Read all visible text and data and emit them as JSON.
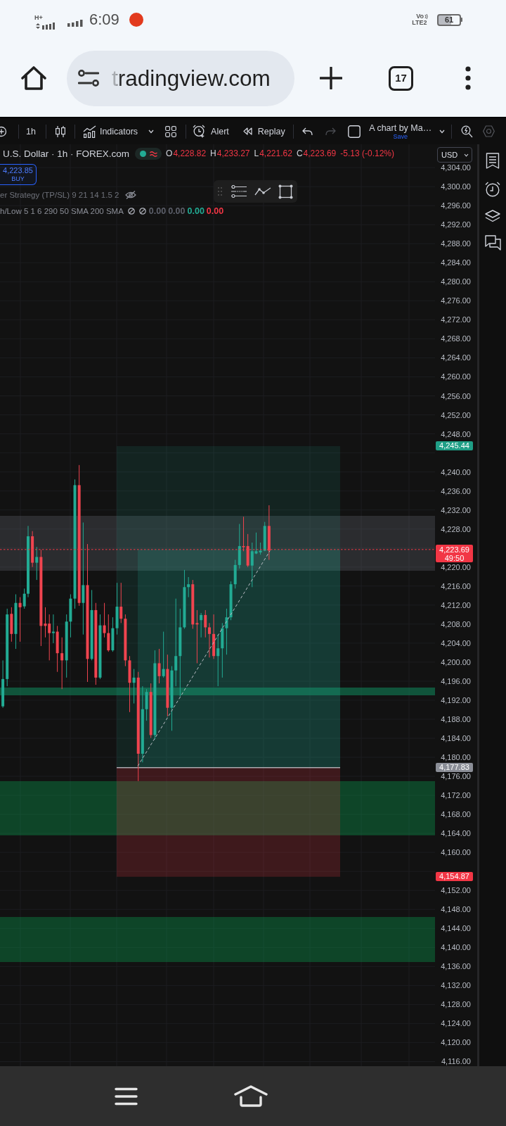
{
  "status_bar": {
    "network_type": "H+",
    "time": "6:09",
    "volte": "Vo",
    "lte": "LTE2",
    "battery": "61"
  },
  "browser": {
    "url": "tradingview.com",
    "tab_count": "17"
  },
  "toolbar": {
    "interval": "1h",
    "indicators": "Indicators",
    "alert": "Alert",
    "replay": "Replay",
    "layout_name": "A chart by Ma…",
    "save": "Save"
  },
  "legend": {
    "symbol": "U.S. Dollar · 1h · FOREX.com",
    "falling": true,
    "ohlc": [
      {
        "label": "O",
        "value": "4,228.82"
      },
      {
        "label": "H",
        "value": "4,233.27"
      },
      {
        "label": "L",
        "value": "4,221.62"
      },
      {
        "label": "C",
        "value": "4,223.69"
      }
    ],
    "change": "-5.13 (-0.12%)",
    "order_button": {
      "price": "4,223.85",
      "label": "BUY"
    },
    "indicators": [
      {
        "name": "er Strategy (TP/SL) 9 21 14 1.5 2",
        "hidden": true
      },
      {
        "name": "h/Low 5 1 6 290 50 SMA 200 SMA",
        "hidden": false,
        "values": [
          {
            "kind": "na"
          },
          {
            "kind": "na"
          },
          {
            "kind": "value",
            "text": "0.00",
            "color": "#5d606b"
          },
          {
            "kind": "value",
            "text": "0.00",
            "color": "#5d606b"
          },
          {
            "kind": "value",
            "text": "0.00",
            "color": "#22ab94"
          },
          {
            "kind": "value",
            "text": "0.00",
            "color": "#f23645"
          }
        ]
      }
    ]
  },
  "price_scale": {
    "currency": "USD",
    "ticks": [
      "4,304.00",
      "4,300.00",
      "4,296.00",
      "4,292.00",
      "4,288.00",
      "4,284.00",
      "4,280.00",
      "4,276.00",
      "4,272.00",
      "4,268.00",
      "4,264.00",
      "4,260.00",
      "4,256.00",
      "4,252.00",
      "4,248.00",
      "4,240.00",
      "4,236.00",
      "4,232.00",
      "4,228.00",
      "4,220.00",
      "4,216.00",
      "4,212.00",
      "4,208.00",
      "4,204.00",
      "4,200.00",
      "4,196.00",
      "4,192.00",
      "4,188.00",
      "4,184.00",
      "4,180.00",
      "4,176.00",
      "4,172.00",
      "4,168.00",
      "4,164.00",
      "4,160.00",
      "4,152.00",
      "4,148.00",
      "4,144.00",
      "4,140.00",
      "4,136.00",
      "4,132.00",
      "4,128.00",
      "4,124.00",
      "4,120.00",
      "4,116.00"
    ]
  },
  "price_labels": [
    {
      "kind": "target",
      "text": "4,245.44"
    },
    {
      "kind": "last",
      "text": "4,223.69",
      "countdown": "49:50"
    },
    {
      "kind": "entry",
      "text": "4,177.83"
    },
    {
      "kind": "stop",
      "text": "4,154.87"
    }
  ]
}
